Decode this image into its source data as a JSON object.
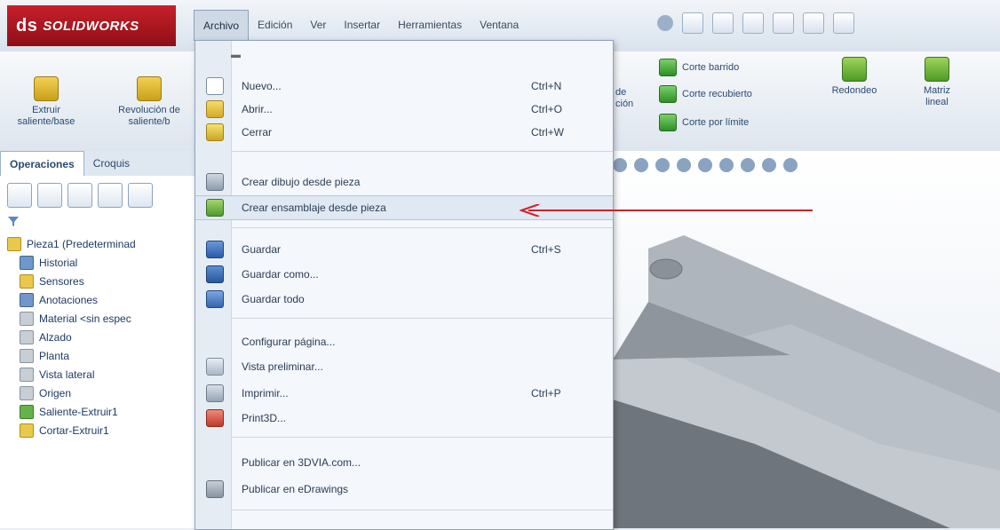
{
  "app": {
    "logo_text": "SOLIDWORKS",
    "logo_prefix": "ds"
  },
  "menubar": {
    "items": [
      "Archivo",
      "Edición",
      "Ver",
      "Insertar",
      "Herramientas",
      "Ventana"
    ]
  },
  "ribbon": {
    "left_buttons": [
      {
        "label": "Extruir saliente/base",
        "icon": "extrude-boss-icon"
      },
      {
        "label": "Revolución de saliente/b",
        "icon": "revolve-boss-icon"
      }
    ],
    "right_rows": [
      {
        "label": "Corte barrido",
        "icon": "cut-sweep-icon"
      },
      {
        "label": "Corte recubierto",
        "icon": "cut-loft-icon"
      },
      {
        "label": "Corte por límite",
        "icon": "cut-boundary-icon"
      }
    ],
    "partial_labels": [
      "de",
      "ción"
    ],
    "right_buttons": [
      {
        "label": "Redondeo",
        "icon": "fillet-icon"
      },
      {
        "label": "Matriz lineal",
        "icon": "linear-pattern-icon"
      }
    ]
  },
  "panel_tabs": [
    "Operaciones",
    "Croquis"
  ],
  "tree": {
    "items": [
      {
        "label": "Pieza1  (Predeterminad",
        "icon": "part-icon",
        "kind": ""
      },
      {
        "label": "Historial",
        "icon": "history-icon",
        "kind": "blue"
      },
      {
        "label": "Sensores",
        "icon": "sensors-icon",
        "kind": ""
      },
      {
        "label": "Anotaciones",
        "icon": "annotations-icon",
        "kind": "blue"
      },
      {
        "label": "Material <sin espec",
        "icon": "material-icon",
        "kind": "gray"
      },
      {
        "label": "Alzado",
        "icon": "plane-icon",
        "kind": "gray"
      },
      {
        "label": "Planta",
        "icon": "plane-icon",
        "kind": "gray"
      },
      {
        "label": "Vista lateral",
        "icon": "plane-icon",
        "kind": "gray"
      },
      {
        "label": "Origen",
        "icon": "origin-icon",
        "kind": "gray"
      },
      {
        "label": "Saliente-Extruir1",
        "icon": "extrude-feature-icon",
        "kind": "green"
      },
      {
        "label": "Cortar-Extruir1",
        "icon": "cut-feature-icon",
        "kind": ""
      }
    ]
  },
  "file_menu": {
    "items": [
      {
        "label": "Nuevo...",
        "shortcut": "Ctrl+N",
        "icon": "new-document-icon"
      },
      {
        "label": "Abrir...",
        "shortcut": "Ctrl+O",
        "icon": "open-folder-icon"
      },
      {
        "label": "Cerrar",
        "shortcut": "Ctrl+W",
        "icon": "close-folder-icon"
      },
      {
        "label": "Crear dibujo desde pieza",
        "shortcut": "",
        "icon": "make-drawing-icon"
      },
      {
        "label": "Crear ensamblaje desde pieza",
        "shortcut": "",
        "icon": "make-assembly-icon"
      },
      {
        "label": "Guardar",
        "shortcut": "Ctrl+S",
        "icon": "save-icon"
      },
      {
        "label": "Guardar como...",
        "shortcut": "",
        "icon": "save-as-icon"
      },
      {
        "label": "Guardar todo",
        "shortcut": "",
        "icon": "save-all-icon"
      },
      {
        "label": "Configurar página...",
        "shortcut": "",
        "icon": ""
      },
      {
        "label": "Vista preliminar...",
        "shortcut": "",
        "icon": "print-preview-icon"
      },
      {
        "label": "Imprimir...",
        "shortcut": "Ctrl+P",
        "icon": "print-icon"
      },
      {
        "label": "Print3D...",
        "shortcut": "",
        "icon": "print3d-icon"
      },
      {
        "label": "Publicar en 3DVIA.com...",
        "shortcut": "",
        "icon": ""
      },
      {
        "label": "Publicar en eDrawings",
        "shortcut": "",
        "icon": "edrawings-icon"
      }
    ]
  },
  "colors": {
    "brand": "#c8202a",
    "arrow": "#d0202a",
    "menu_highlight": "#dfe8f3",
    "model_gray": "#8e959d"
  }
}
